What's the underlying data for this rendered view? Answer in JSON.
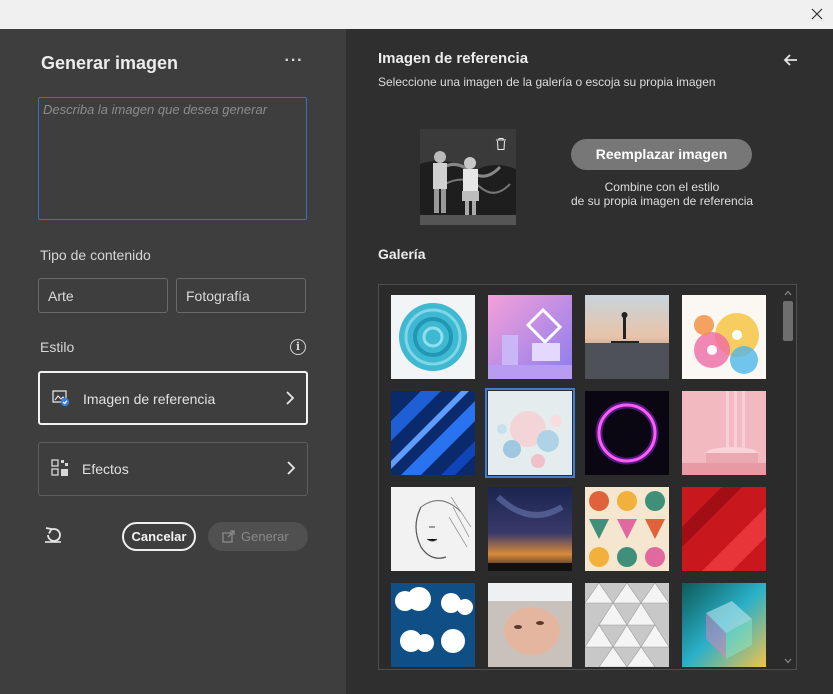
{
  "window": {
    "close_icon": "close-icon"
  },
  "left_panel": {
    "title": "Generar imagen",
    "more_label": "···",
    "prompt_placeholder": "Describa la imagen que desea generar",
    "content_type": {
      "label": "Tipo de contenido",
      "options": [
        "Arte",
        "Fotografía"
      ]
    },
    "style": {
      "label": "Estilo",
      "info_glyph": "i",
      "options": [
        {
          "label": "Imagen de referencia",
          "icon": "reference-image-icon",
          "active": true
        },
        {
          "label": "Efectos",
          "icon": "effects-icon",
          "active": false
        }
      ]
    },
    "actions": {
      "reset_icon": "reset-icon",
      "cancel_label": "Cancelar",
      "generate_label": "Generar"
    }
  },
  "right_panel": {
    "title": "Imagen de referencia",
    "subtitle": "Seleccione una imagen de la galería o escoja su propia imagen",
    "back_icon": "arrow-left-icon",
    "replace_button": "Reemplazar imagen",
    "replace_help_line1": "Combine con el estilo",
    "replace_help_line2": "de su propia imagen de referencia",
    "gallery_title": "Galería",
    "selected_index": 5
  },
  "colors": {
    "left_bg": "#3e3e3e",
    "right_bg": "#2f2f2f",
    "accent": "#3d6fc4",
    "text": "#ececec"
  }
}
